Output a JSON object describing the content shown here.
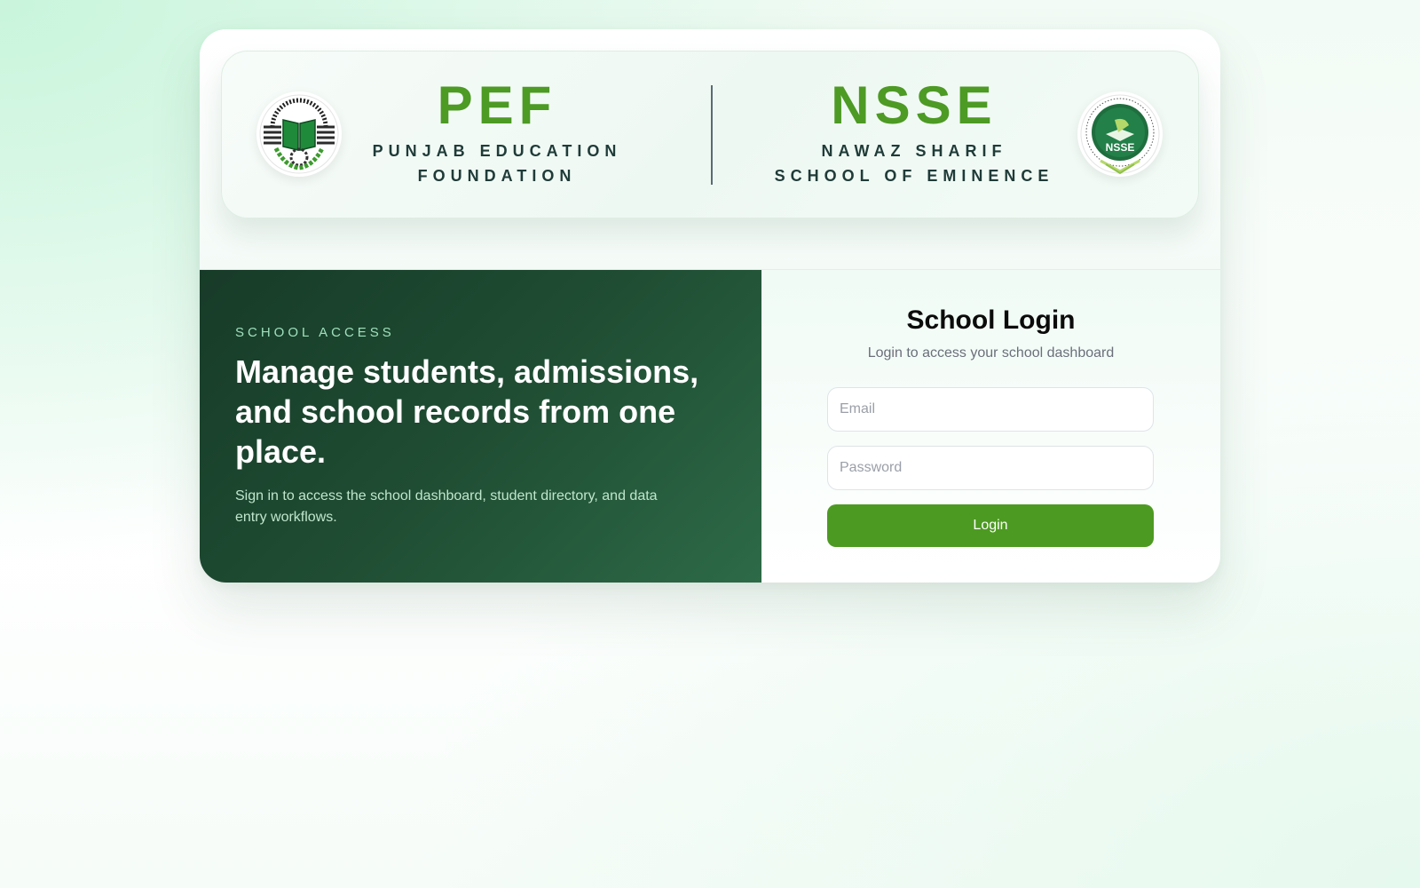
{
  "header": {
    "left_brand": {
      "abbr": "PEF",
      "full_line1": "PUNJAB EDUCATION",
      "full_line2": "FOUNDATION",
      "logo_icon": "pef-emblem-icon"
    },
    "right_brand": {
      "abbr": "NSSE",
      "full_line1": "NAWAZ SHARIF",
      "full_line2": "SCHOOL OF EMINENCE",
      "logo_icon": "nsse-emblem-icon",
      "logo_text": "NSSE"
    }
  },
  "hero": {
    "eyebrow": "SCHOOL ACCESS",
    "headline": "Manage students, admissions, and school records from one place.",
    "description": "Sign in to access the school dashboard, student directory, and data entry workflows."
  },
  "login": {
    "title": "School Login",
    "subtitle": "Login to access your school dashboard",
    "email_placeholder": "Email",
    "email_value": "",
    "password_placeholder": "Password",
    "password_value": "",
    "button_label": "Login"
  },
  "colors": {
    "brand_green": "#4d9a24",
    "dark_panel": "#1f4d33",
    "button_green": "#4d9a22",
    "brand_text": "#1f3b38"
  }
}
